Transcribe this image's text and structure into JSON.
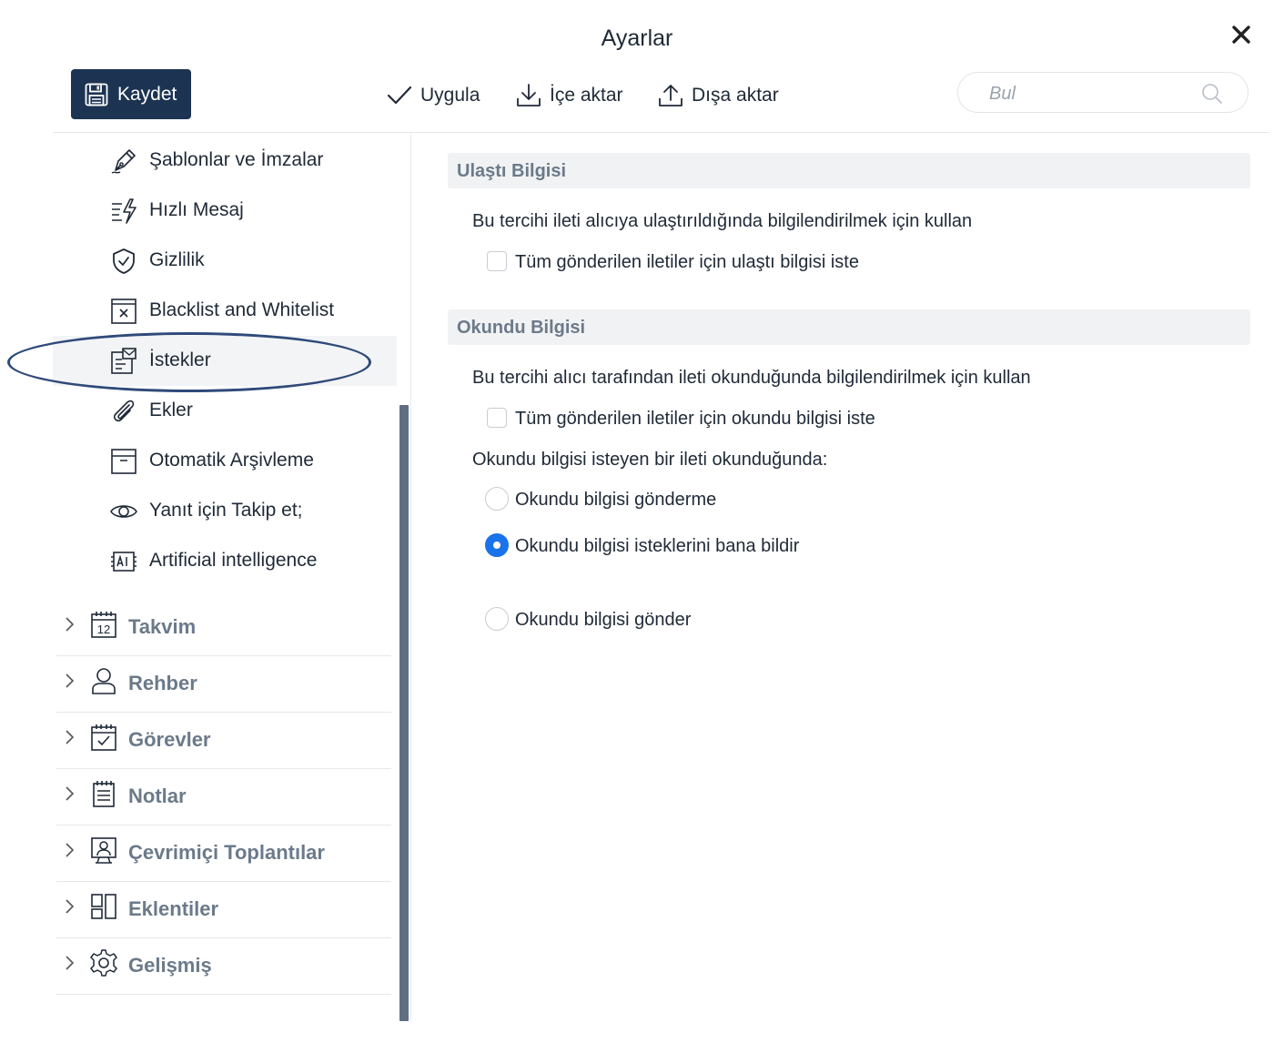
{
  "window": {
    "title": "Ayarlar"
  },
  "toolbar": {
    "save_label": "Kaydet",
    "apply_label": "Uygula",
    "import_label": "İçe aktar",
    "export_label": "Dışa aktar"
  },
  "search": {
    "placeholder": "Bul",
    "value": ""
  },
  "sidebar": {
    "items": [
      {
        "label": "Şablonlar ve İmzalar",
        "icon": "pen-icon"
      },
      {
        "label": "Hızlı Mesaj",
        "icon": "quick-message-icon"
      },
      {
        "label": "Gizlilik",
        "icon": "shield-icon"
      },
      {
        "label": "Blacklist and Whitelist",
        "icon": "blacklist-icon"
      },
      {
        "label": "İstekler",
        "icon": "requests-icon",
        "selected": true
      },
      {
        "label": "Ekler",
        "icon": "paperclip-icon"
      },
      {
        "label": "Otomatik Arşivleme",
        "icon": "archive-icon"
      },
      {
        "label": "Yanıt için Takip et;",
        "icon": "eye-icon"
      },
      {
        "label": "Artificial intelligence",
        "icon": "ai-icon"
      }
    ],
    "categories": [
      {
        "label": "Takvim",
        "icon": "calendar-icon",
        "calendar_day": "12"
      },
      {
        "label": "Rehber",
        "icon": "contact-icon"
      },
      {
        "label": "Görevler",
        "icon": "tasks-icon"
      },
      {
        "label": "Notlar",
        "icon": "notes-icon"
      },
      {
        "label": "Çevrimiçi Toplantılar",
        "icon": "meeting-icon"
      },
      {
        "label": "Eklentiler",
        "icon": "addons-icon"
      },
      {
        "label": "Gelişmiş",
        "icon": "gear-icon"
      }
    ]
  },
  "content": {
    "delivery": {
      "header": "Ulaştı Bilgisi",
      "description": "Bu tercihi ileti alıcıya ulaştırıldığında bilgilendirilmek için kullan",
      "checkbox_label": "Tüm gönderilen iletiler için ulaştı bilgisi iste",
      "checkbox_checked": false
    },
    "read": {
      "header": "Okundu Bilgisi",
      "description": "Bu tercihi alıcı tarafından ileti okunduğunda bilgilendirilmek için kullan",
      "checkbox_label": "Tüm gönderilen iletiler için okundu bilgisi iste",
      "checkbox_checked": false,
      "question": "Okundu bilgisi isteyen bir ileti okunduğunda:",
      "options": [
        {
          "label": "Okundu bilgisi gönderme",
          "selected": false
        },
        {
          "label": "Okundu bilgisi isteklerini bana bildir",
          "selected": true
        },
        {
          "label": "Okundu bilgisi gönder",
          "selected": false
        }
      ]
    }
  },
  "colors": {
    "primary": "#1c3452",
    "accent": "#1a73e8",
    "highlight_outline": "#2f4a7a",
    "scrollbar": "#5f6f82",
    "muted_text": "#6b7a8a"
  }
}
